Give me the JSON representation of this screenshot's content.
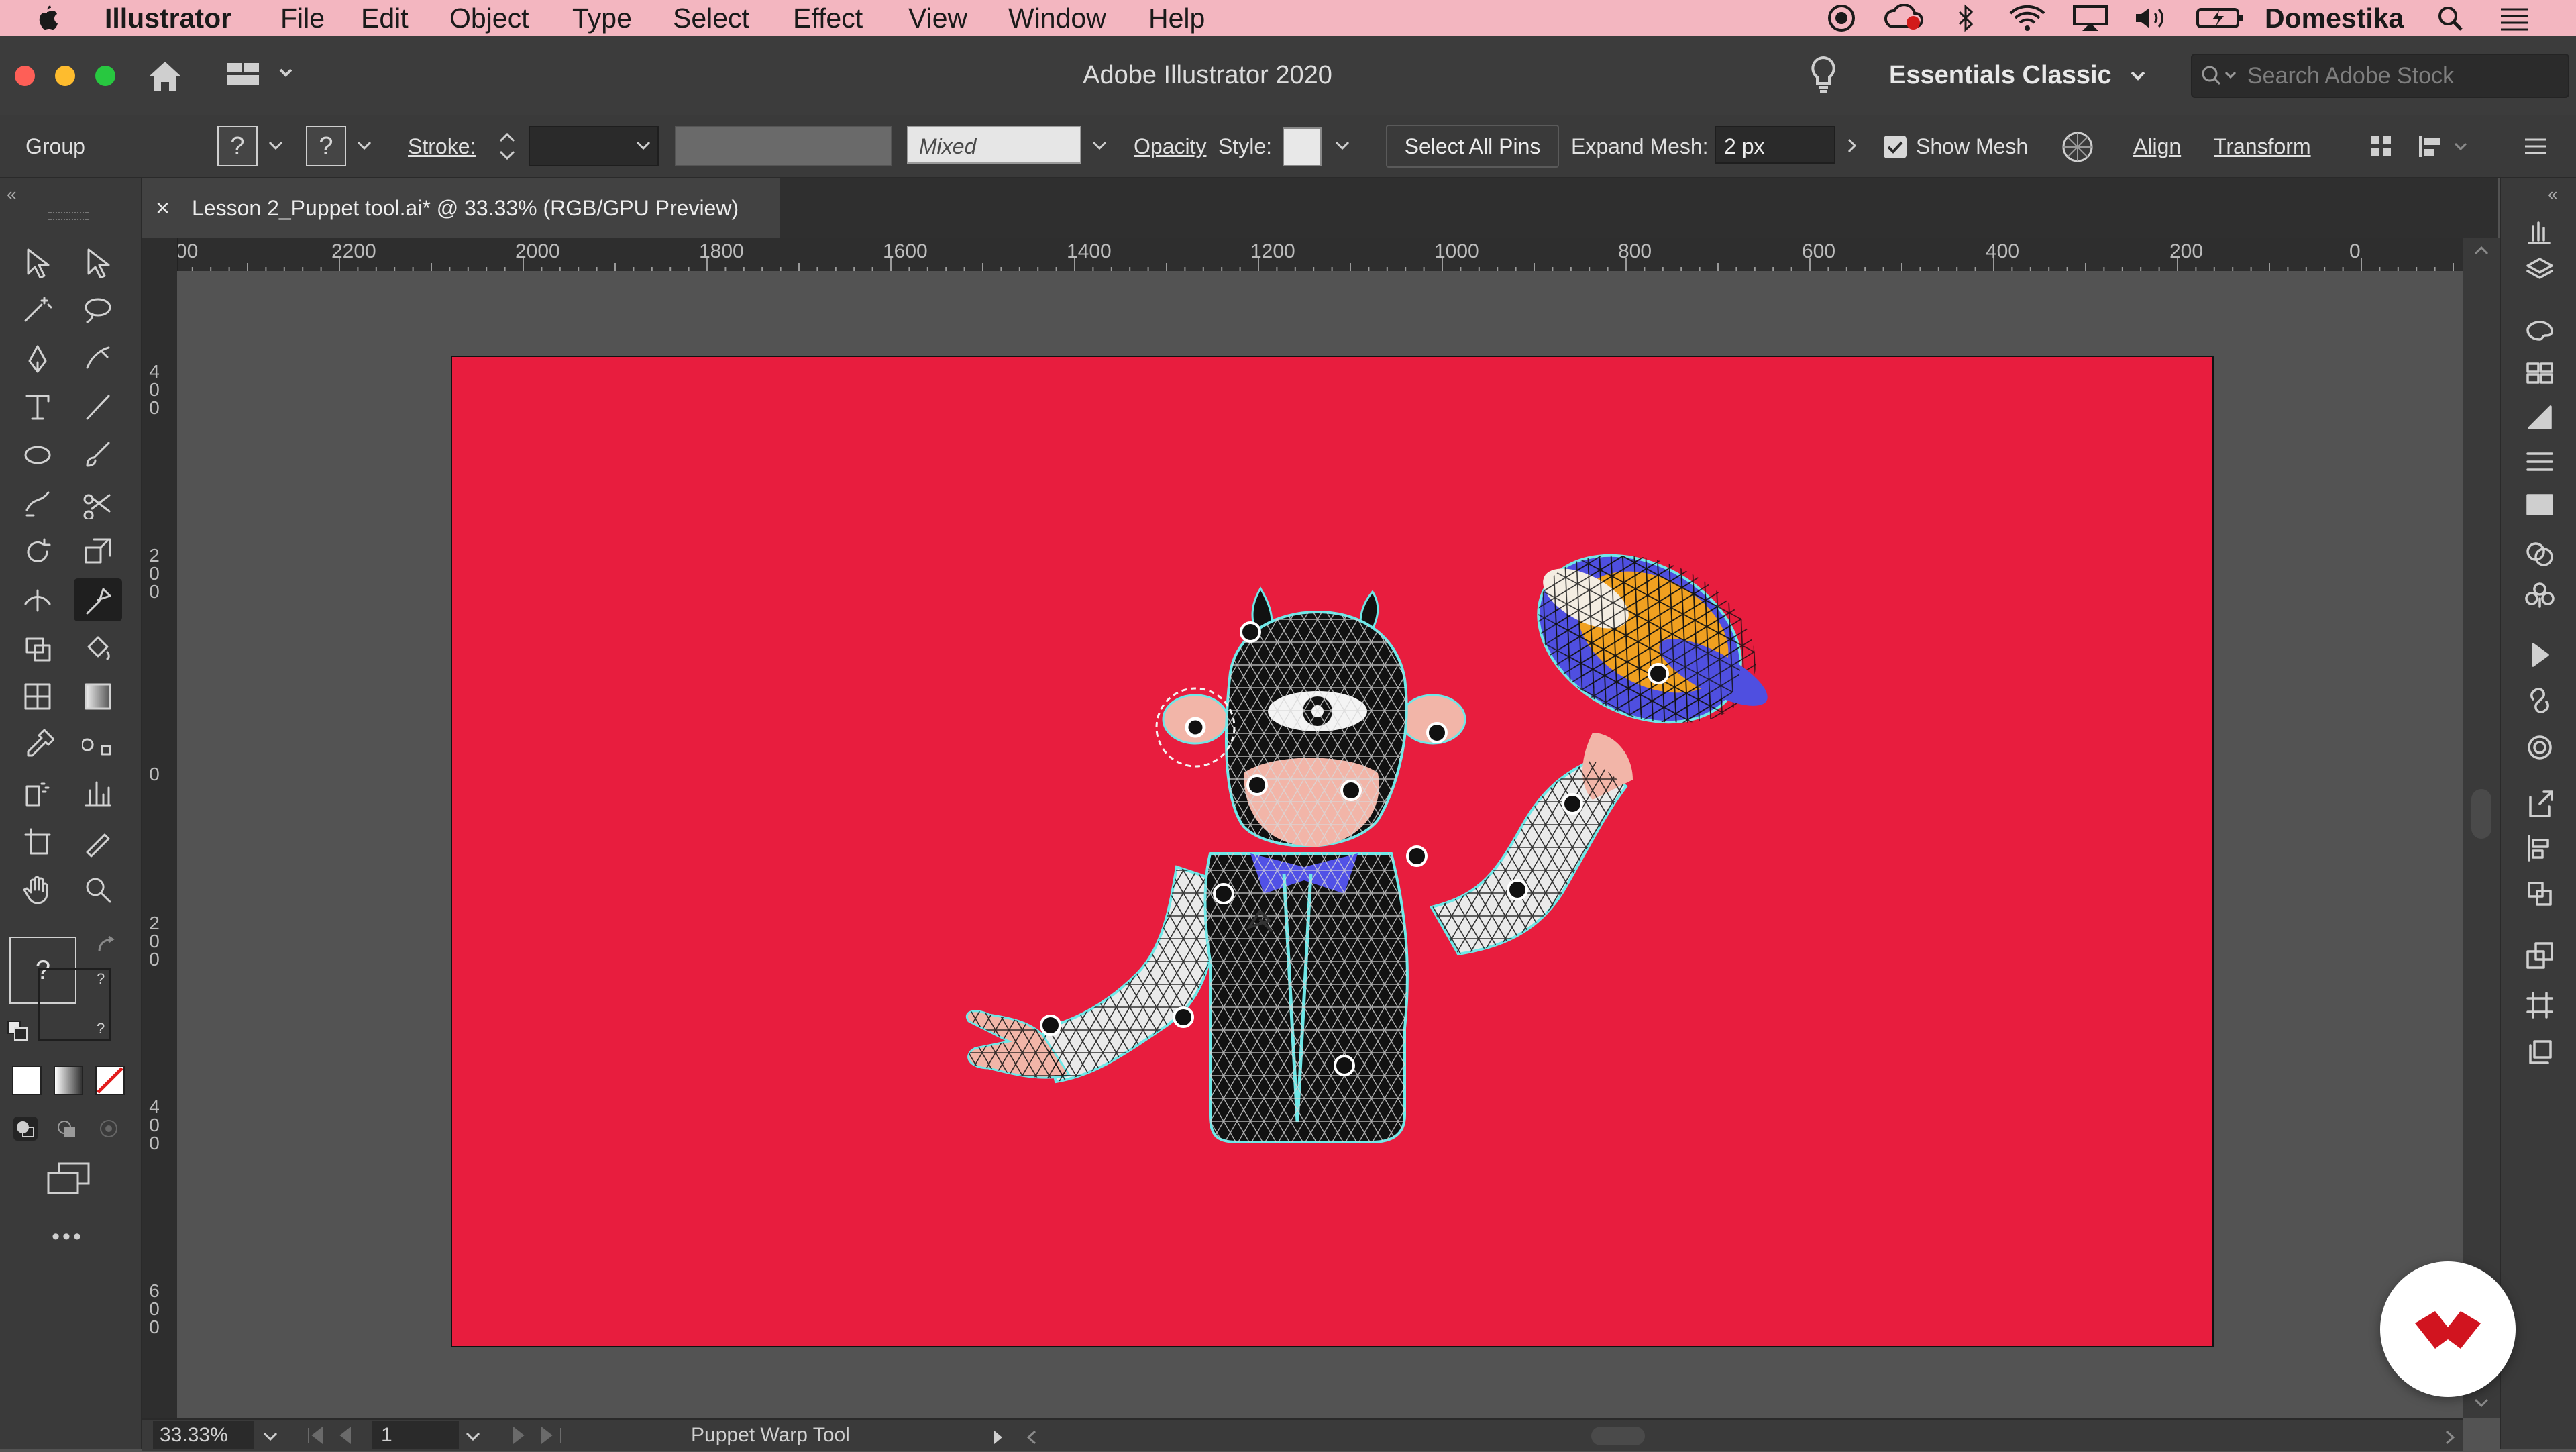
{
  "menubar": {
    "apple_icon": "apple-icon",
    "app_name": "Illustrator",
    "menus": [
      "File",
      "Edit",
      "Object",
      "Type",
      "Select",
      "Effect",
      "View",
      "Window",
      "Help"
    ],
    "user_name": "Domestika",
    "status_icons": [
      "record-icon",
      "creative-cloud-icon",
      "bluetooth-icon",
      "wifi-icon",
      "airplay-icon",
      "volume-icon",
      "battery-icon",
      "spotlight-icon",
      "list-icon"
    ]
  },
  "titlebar": {
    "title": "Adobe Illustrator 2020",
    "workspace": "Essentials Classic",
    "search_placeholder": "Search Adobe Stock"
  },
  "controlbar": {
    "selection_label": "Group",
    "fill_placeholder": "?",
    "stroke_placeholder": "?",
    "stroke_label": "Stroke:",
    "mixed_value": "Mixed",
    "opacity_label": "Opacity",
    "style_label": "Style:",
    "select_all_pins": "Select All Pins",
    "expand_mesh_label": "Expand Mesh:",
    "expand_mesh_value": "2 px",
    "show_mesh_label": "Show Mesh",
    "show_mesh_checked": true,
    "align_label": "Align",
    "transform_label": "Transform"
  },
  "document": {
    "tab_title": "Lesson 2_Puppet tool.ai* @ 33.33% (RGB/GPU Preview)",
    "close_glyph": "×"
  },
  "ruler": {
    "horizontal": [
      "00",
      "2200",
      "2000",
      "1800",
      "1600",
      "1400",
      "1200",
      "1000",
      "800",
      "600",
      "400",
      "200",
      "0"
    ],
    "vertical": [
      "4\n0\n0",
      "2\n0\n0",
      "0",
      "2\n0\n0",
      "4\n0\n0",
      "6\n0\n0"
    ]
  },
  "toolbar": {
    "unknown_color": "?",
    "more_tools": "•••",
    "active_tool": "puppet-warp-tool"
  },
  "statusbar": {
    "zoom": "33.33%",
    "artboard_number": "1",
    "current_tool": "Puppet Warp Tool"
  },
  "colors": {
    "artboard": "#e81d3e",
    "menubar": "#f3b6c0",
    "chrome": "#3a3a3a",
    "badge_logo": "#d1141f"
  }
}
